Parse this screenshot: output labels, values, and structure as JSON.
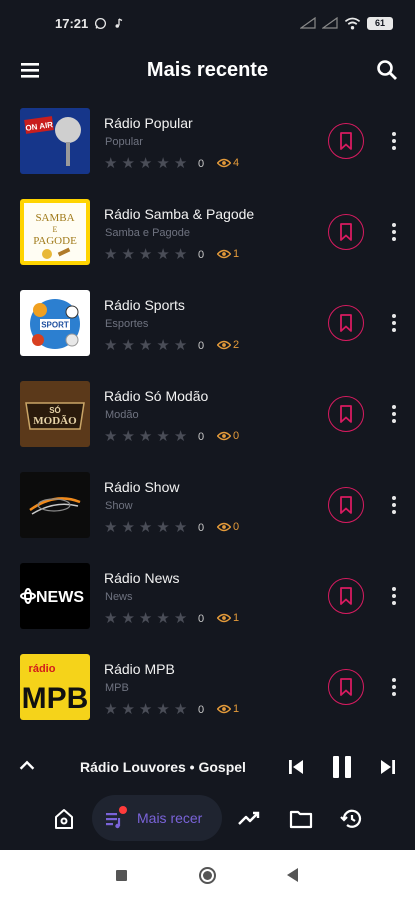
{
  "status_bar": {
    "time": "17:21",
    "battery": "61"
  },
  "app_bar": {
    "title": "Mais recente"
  },
  "stations": [
    {
      "name": "Rádio Popular",
      "genre": "Popular",
      "rating_count": "0",
      "views": "4",
      "logo": "on-air-microphone"
    },
    {
      "name": "Rádio Samba & Pagode",
      "genre": "Samba e Pagode",
      "rating_count": "0",
      "views": "1",
      "logo": "samba-pagode",
      "logo_text": [
        "SAMBA",
        "E",
        "PAGODE"
      ]
    },
    {
      "name": "Rádio Sports",
      "genre": "Esportes",
      "rating_count": "0",
      "views": "2",
      "logo": "sport",
      "logo_text": [
        "SPORT"
      ]
    },
    {
      "name": "Rádio Só Modão",
      "genre": "Modão",
      "rating_count": "0",
      "views": "0",
      "logo": "so-modao",
      "logo_text": [
        "SÓ",
        "MODÃO"
      ]
    },
    {
      "name": "Rádio Show",
      "genre": "Show",
      "rating_count": "0",
      "views": "0",
      "logo": "radio-show"
    },
    {
      "name": "Rádio News",
      "genre": "News",
      "rating_count": "0",
      "views": "1",
      "logo": "abc-news",
      "logo_text": [
        "NEWS"
      ]
    },
    {
      "name": "Rádio MPB",
      "genre": "MPB",
      "rating_count": "0",
      "views": "1",
      "logo": "radio-mpb",
      "logo_text": [
        "rádio",
        "MPB"
      ]
    }
  ],
  "player": {
    "now_playing": "Rádio Louvores • Gospel"
  },
  "bottom_nav": {
    "active_label": "Mais recer"
  },
  "colors": {
    "background": "#14171f",
    "accent": "#d81b60",
    "views": "#e39a3a",
    "nav_active": "#7a63d9"
  }
}
